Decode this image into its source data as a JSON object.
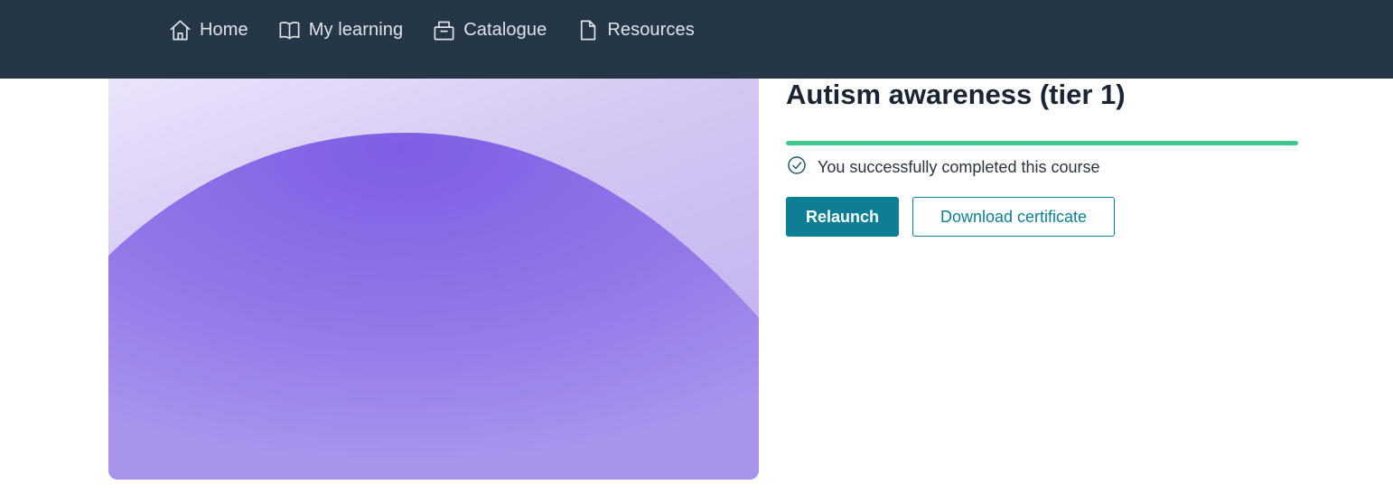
{
  "nav": {
    "items": [
      {
        "label": "Home",
        "icon": "home-icon"
      },
      {
        "label": "My learning",
        "icon": "book-icon"
      },
      {
        "label": "Catalogue",
        "icon": "catalogue-icon"
      },
      {
        "label": "Resources",
        "icon": "document-icon"
      }
    ]
  },
  "course": {
    "title": "Autism awareness (tier 1)",
    "progress_percent": 100,
    "status_text": "You successfully completed this course",
    "status_icon": "check-circle-icon",
    "relaunch_label": "Relaunch",
    "download_label": "Download certificate"
  },
  "colors": {
    "header_bg": "#253647",
    "accent": "#0c7f94",
    "progress": "#3ec98a",
    "image_purple": "#8a6ae6"
  }
}
